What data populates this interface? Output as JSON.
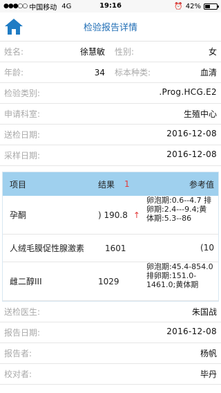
{
  "status_bar": {
    "carrier": "中国移动",
    "network": "4G",
    "time": "19:16",
    "battery_text": "42%",
    "battery_level": 0.42
  },
  "nav": {
    "title": "检验报告详情",
    "home_icon": "home-icon"
  },
  "info": {
    "name_label": "姓名:",
    "name_value": "徐慧敏",
    "gender_label": "性别:",
    "gender_value": "女",
    "age_label": "年龄:",
    "age_value": "34",
    "sample_label": "标本种类:",
    "sample_value": "血清",
    "category_label": "检验类别:",
    "category_value": ".Prog.HCG.E2",
    "dept_label": "申请科室:",
    "dept_value": "生殖中心",
    "send_date_label": "送检日期:",
    "send_date_value": "2016-12-08",
    "collect_date_label": "采样日期:",
    "collect_date_value": "2016-12-08"
  },
  "table": {
    "headers": {
      "item": "项目",
      "result": "结果",
      "abnormal_count": "1",
      "reference": "参考值"
    },
    "rows": [
      {
        "item": "孕酮",
        "result": ") 190.8",
        "flag": "↑",
        "reference": "卵泡期:0.6--4.7 排卵期:2.4---9.4;黄体期:5.3--86"
      },
      {
        "item": "人绒毛膜促性腺激素",
        "result": "1601",
        "flag": "",
        "reference": "(10"
      },
      {
        "item": "雌二醇III",
        "result": "1029",
        "flag": "",
        "reference": "卵泡期:45.4-854.0 排卵期:151.0-1461.0;黄体期"
      }
    ]
  },
  "footer": {
    "doctor_label": "送检医生:",
    "doctor_value": "朱国战",
    "report_date_label": "报告日期:",
    "report_date_value": "2016-12-08",
    "reporter_label": "报告者:",
    "reporter_value": "杨帆",
    "checker_label": "校对者:",
    "checker_value": "毕丹"
  },
  "colors": {
    "title_blue": "#1f6db5",
    "header_bg": "#9fd0ee",
    "alert_red": "#e23a3a"
  }
}
